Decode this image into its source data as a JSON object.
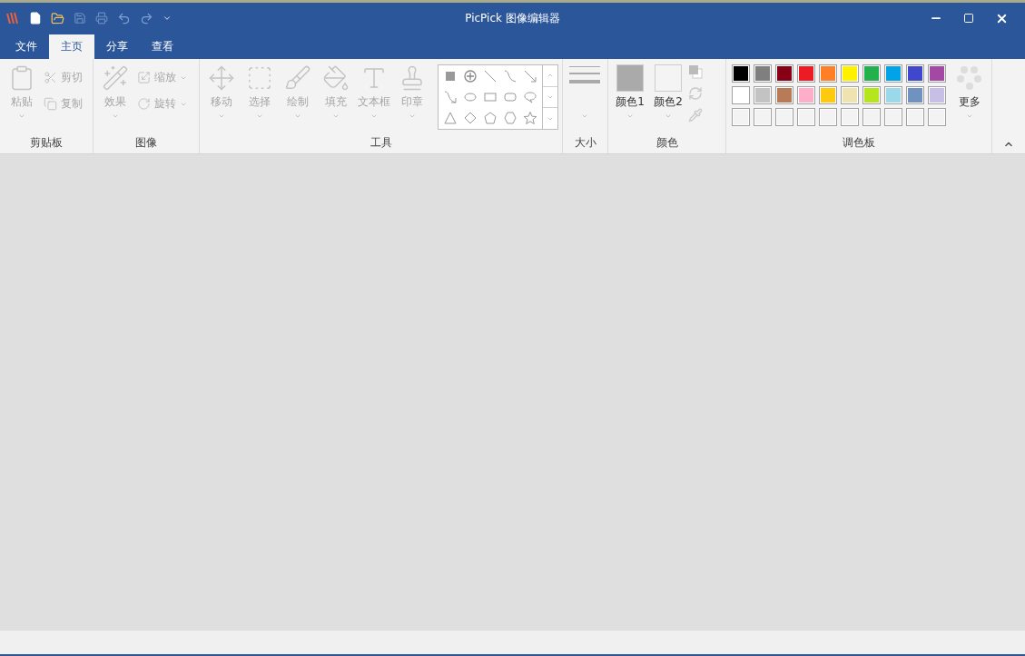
{
  "window": {
    "title": "PicPick 图像编辑器"
  },
  "tabs": [
    {
      "label": "文件",
      "selected": false
    },
    {
      "label": "主页",
      "selected": true
    },
    {
      "label": "分享",
      "selected": false
    },
    {
      "label": "查看",
      "selected": false
    }
  ],
  "ribbon": {
    "clipboard": {
      "title": "剪贴板",
      "large": [
        {
          "label": "粘贴",
          "kind": "paste",
          "disabled": true
        }
      ],
      "small": [
        {
          "label": "剪切",
          "kind": "cut",
          "disabled": true
        },
        {
          "label": "复制",
          "kind": "copy",
          "disabled": true
        }
      ]
    },
    "image": {
      "title": "图像",
      "large": [
        {
          "label": "效果",
          "kind": "effects",
          "disabled": true
        }
      ],
      "small": [
        {
          "label": "缩放",
          "kind": "resize",
          "disabled": true
        },
        {
          "label": "旋转",
          "kind": "rotate",
          "disabled": true
        }
      ]
    },
    "tools": {
      "title": "工具",
      "large": [
        {
          "label": "移动",
          "kind": "move",
          "disabled": true
        },
        {
          "label": "选择",
          "kind": "select",
          "disabled": true
        },
        {
          "label": "绘制",
          "kind": "draw",
          "disabled": true
        },
        {
          "label": "填充",
          "kind": "fill",
          "disabled": true
        },
        {
          "label": "文本框",
          "kind": "text",
          "disabled": true
        },
        {
          "label": "印章",
          "kind": "stamp",
          "disabled": true
        }
      ]
    },
    "size": {
      "title": "大小"
    },
    "color": {
      "title": "颜色",
      "swatches": [
        {
          "label": "颜色1",
          "color": "#aaaaaa"
        },
        {
          "label": "颜色2",
          "color": "#f4f4f4"
        }
      ]
    },
    "palette": {
      "title": "调色板",
      "colors": [
        {
          "color": "#000000"
        },
        {
          "color": "#7f7f7f"
        },
        {
          "color": "#880015"
        },
        {
          "color": "#ed1c24"
        },
        {
          "color": "#ff7f27"
        },
        {
          "color": "#fff200"
        },
        {
          "color": "#22b14c"
        },
        {
          "color": "#00a2e8"
        },
        {
          "color": "#3f48cc"
        },
        {
          "color": "#a349a4"
        },
        {
          "color": "#ffffff"
        },
        {
          "color": "#c3c3c3"
        },
        {
          "color": "#b97a57"
        },
        {
          "color": "#ffaec9"
        },
        {
          "color": "#ffc90e"
        },
        {
          "color": "#efe4b0"
        },
        {
          "color": "#b5e61d"
        },
        {
          "color": "#99d9ea"
        },
        {
          "color": "#7092be"
        },
        {
          "color": "#c8bfe7"
        }
      ],
      "more": "更多"
    }
  }
}
